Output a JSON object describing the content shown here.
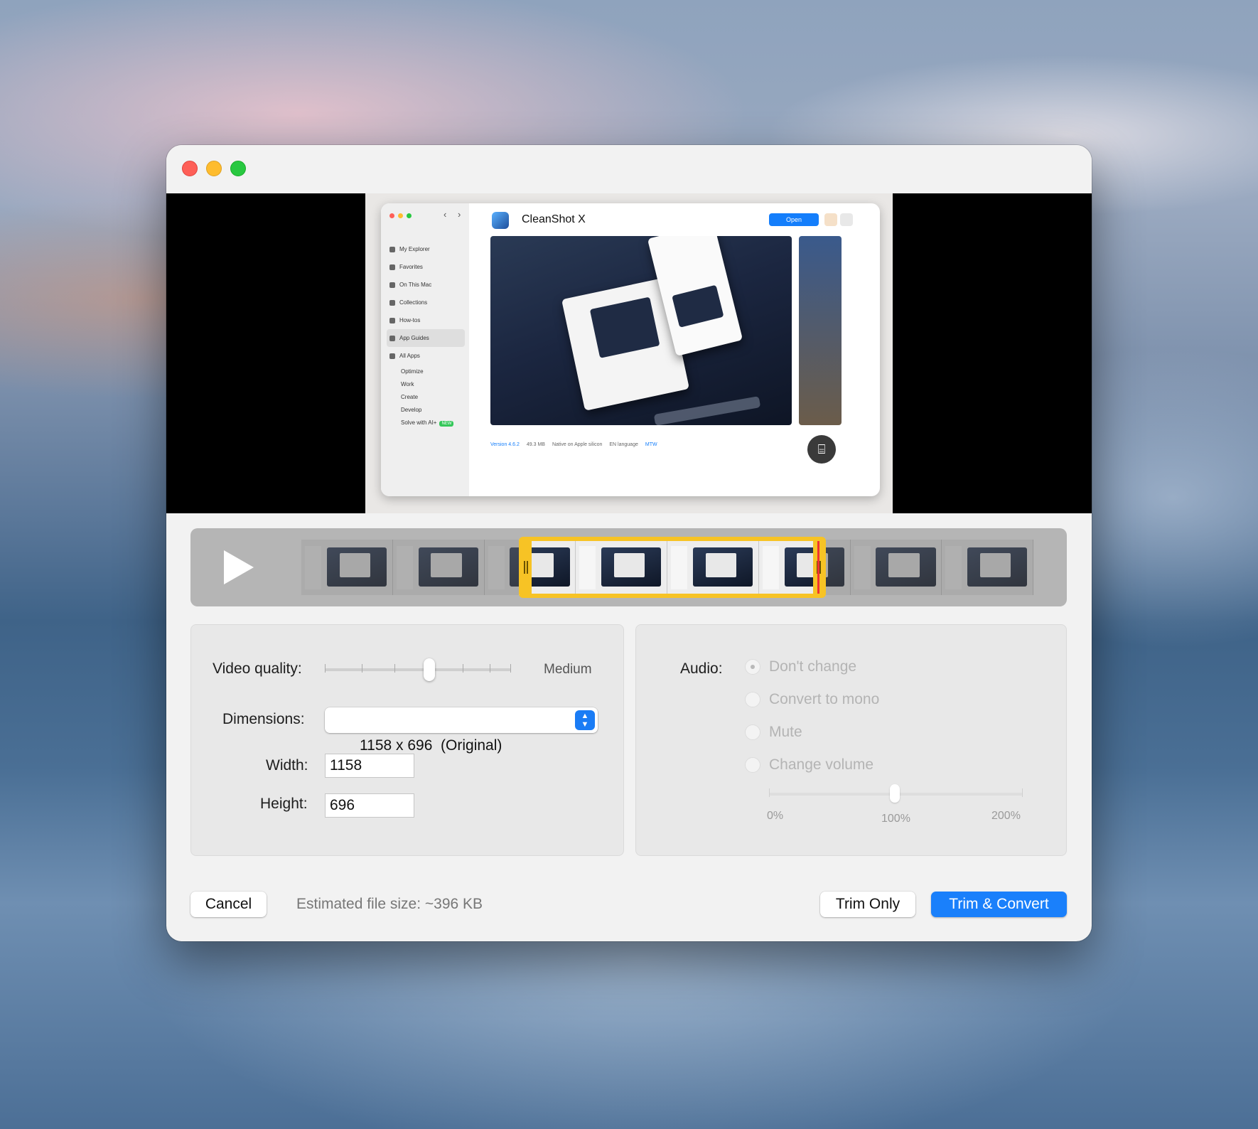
{
  "window": {
    "controls": [
      "close",
      "minimize",
      "zoom"
    ]
  },
  "preview": {
    "app_title": "CleanShot X",
    "open_button": "Open",
    "sidebar": [
      {
        "label": "My Explorer",
        "icon": "leaf-icon"
      },
      {
        "label": "Favorites",
        "icon": "heart-icon"
      },
      {
        "label": "On This Mac",
        "icon": "download-icon"
      },
      {
        "label": "Collections",
        "icon": "folder-icon"
      },
      {
        "label": "How-tos",
        "icon": "lightbulb-icon"
      },
      {
        "label": "App Guides",
        "icon": "book-icon"
      },
      {
        "label": "All Apps",
        "icon": "diamond-icon"
      }
    ],
    "sidebar_sub": [
      "Optimize",
      "Work",
      "Create",
      "Develop",
      "Solve with AI+"
    ],
    "new_badge": "NEW",
    "footer": [
      "Version 4.6.2",
      "49.3 MB",
      "Native on Apple silicon",
      "EN language",
      "MTW"
    ]
  },
  "timeline": {
    "thumbnail_count": 8,
    "selection_start": 0.3,
    "selection_end": 0.71
  },
  "settings": {
    "video_quality_label": "Video quality:",
    "video_quality_value": "Medium",
    "video_quality_level": 0.5,
    "dimensions_label": "Dimensions:",
    "dimensions_value": "1158 x 696  (Original)",
    "width_label": "Width:",
    "width_value": "1158",
    "height_label": "Height:",
    "height_value": "696"
  },
  "audio": {
    "label": "Audio:",
    "options": [
      "Don't change",
      "Convert to mono",
      "Mute",
      "Change volume"
    ],
    "selected": "Don't change",
    "volume_min": "0%",
    "volume_mid": "100%",
    "volume_max": "200%",
    "volume_level": 0.5
  },
  "footer": {
    "cancel": "Cancel",
    "estimate": "Estimated file size: ~396 KB",
    "trim_only": "Trim Only",
    "trim_convert": "Trim & Convert"
  },
  "colors": {
    "accent": "#1a80fb",
    "selection": "#f7c325"
  }
}
